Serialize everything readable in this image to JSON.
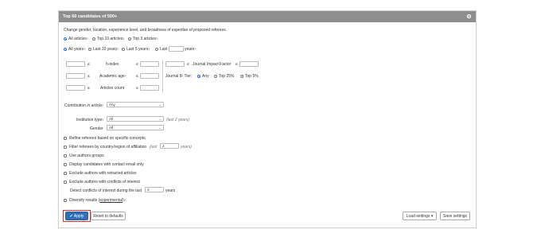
{
  "panel": {
    "title": "Top 60 candidates of 500+"
  },
  "intro": "Change gender, location, experience level, and broadness of expertise of proposed referees.",
  "articles_filter": {
    "options": [
      "All articles",
      "Top 10 articles",
      "Top 3 articles"
    ],
    "selected": 0
  },
  "years_filter": {
    "options": [
      "All years",
      "Last 10 years",
      "Last 5 years",
      "Last"
    ],
    "suffix": "years",
    "last_value": "",
    "selected": 0
  },
  "metrics": {
    "rows": [
      {
        "label": "h-index",
        "le1": "≤",
        "le2": "≤",
        "min": "",
        "max": ""
      },
      {
        "label": "Academic age",
        "le1": "≤",
        "le2": "≤",
        "min": "",
        "max": ""
      },
      {
        "label": "Articles count",
        "le1": "≤",
        "le2": "≤",
        "min": "",
        "max": ""
      }
    ],
    "jif": {
      "label": "Journal Impact Factor",
      "le1": "≤",
      "le2": "≤",
      "min": "",
      "max": ""
    },
    "jif_tier": {
      "label": "Journal IF Tier:",
      "options": [
        "Any",
        "Top 25%",
        "Top 5%"
      ],
      "selected": 0
    }
  },
  "contribution": {
    "label_prefix": "Contribution",
    "label_italic": "in article",
    "value": "Any"
  },
  "institution_type": {
    "label": "Institution type",
    "value": "All",
    "note": "(last 2 years)"
  },
  "gender": {
    "label": "Gender",
    "value": "All"
  },
  "checkboxes": {
    "refine": "Refine referees based on specific concepts",
    "filter_country": "Filter referees by country/region of affiliation",
    "filter_country_note_pre": "(last",
    "filter_country_value": "2",
    "filter_country_note_post": "years)",
    "author_groups": "Use authors groups",
    "contact_email": "Display candidates with contact email only",
    "retracted": "Exclude authors with retracted articles",
    "conflicts": "Exclude authors with conflicts of interest",
    "detect_label": "Detect conflicts of interest during the last",
    "detect_value": "3",
    "detect_suffix": "years",
    "diversify_pre": "Diversify results (",
    "diversify_link": "experimental",
    "diversify_post": ")"
  },
  "sup": "?",
  "buttons": {
    "apply": "Apply",
    "reset": "Reset to defaults",
    "load": "Load settings",
    "save": "Save settings"
  },
  "colors": {
    "header": "#8e8e8e",
    "primary": "#2e6fb7",
    "highlight": "#d9342b"
  }
}
